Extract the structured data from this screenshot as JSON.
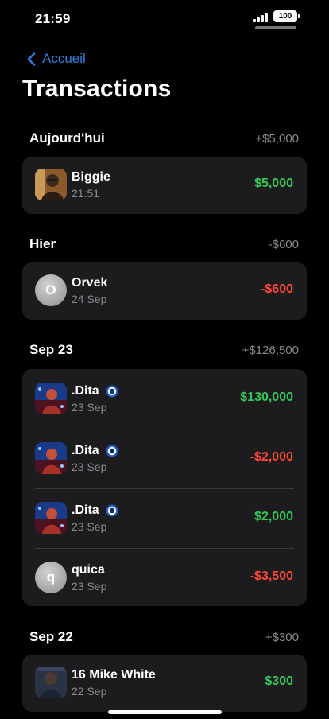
{
  "status": {
    "time": "21:59",
    "battery": "100"
  },
  "nav": {
    "back_label": "Accueil"
  },
  "title": "Transactions",
  "colors": {
    "positive": "#34c759",
    "negative": "#ff453a",
    "accent": "#2f7fe0"
  },
  "sections": [
    {
      "title": "Aujourd'hui",
      "total": "+$5,000",
      "rows": [
        {
          "name": "Biggie",
          "date": "21:51",
          "amount": "$5,000",
          "sign": "positive",
          "avatar": "photo-biggie",
          "verified": false
        }
      ]
    },
    {
      "title": "Hier",
      "total": "-$600",
      "rows": [
        {
          "name": "Orvek",
          "date": "24 Sep",
          "amount": "-$600",
          "sign": "negative",
          "avatar": "initial",
          "initial": "O",
          "verified": false
        }
      ]
    },
    {
      "title": "Sep 23",
      "total": "+$126,500",
      "rows": [
        {
          "name": ".Dita",
          "date": "23 Sep",
          "amount": "$130,000",
          "sign": "positive",
          "avatar": "photo-dita",
          "verified": true
        },
        {
          "name": ".Dita",
          "date": "23 Sep",
          "amount": "-$2,000",
          "sign": "negative",
          "avatar": "photo-dita",
          "verified": true
        },
        {
          "name": ".Dita",
          "date": "23 Sep",
          "amount": "$2,000",
          "sign": "positive",
          "avatar": "photo-dita",
          "verified": true
        },
        {
          "name": "quica",
          "date": "23 Sep",
          "amount": "-$3,500",
          "sign": "negative",
          "avatar": "initial",
          "initial": "q",
          "verified": false
        }
      ]
    },
    {
      "title": "Sep 22",
      "total": "+$300",
      "rows": [
        {
          "name": "16 Mike White",
          "date": "22 Sep",
          "amount": "$300",
          "sign": "positive",
          "avatar": "photo-mike",
          "verified": false
        }
      ]
    }
  ]
}
